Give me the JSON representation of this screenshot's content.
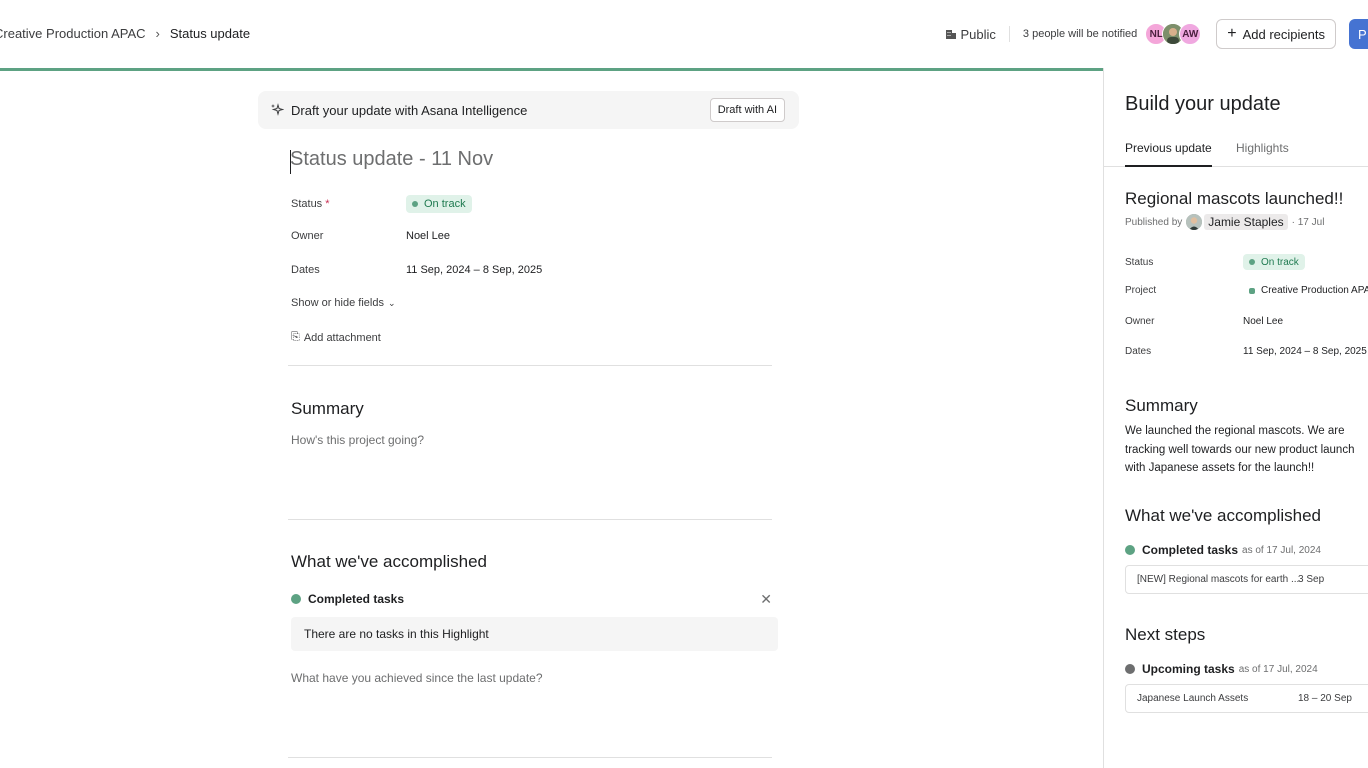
{
  "breadcrumb": {
    "parent": "Creative Production APAC",
    "current": "Status update"
  },
  "topbar": {
    "visibility": "Public",
    "notify_text": "3 people will be notified",
    "avatars": [
      "NL",
      "",
      "AW"
    ],
    "add_recipients": "Add recipients",
    "publish": "P"
  },
  "ai_banner": {
    "text": "Draft your update with Asana Intelligence",
    "button": "Draft with AI"
  },
  "editor": {
    "title_placeholder": "Status update - 11 Nov",
    "fields": {
      "status_label": "Status",
      "required_mark": "*",
      "status_value": "On track",
      "owner_label": "Owner",
      "owner_value": "Noel Lee",
      "dates_label": "Dates",
      "dates_value": "11 Sep, 2024 – 8 Sep, 2025"
    },
    "show_hide_fields": "Show or hide fields",
    "add_attachment": "Add attachment",
    "summary": {
      "heading": "Summary",
      "placeholder": "How's this project going?"
    },
    "accomplished": {
      "heading": "What we've accomplished",
      "highlight_label": "Completed tasks",
      "empty_text": "There are no tasks in this Highlight",
      "placeholder": "What have you achieved since the last update?"
    }
  },
  "panel": {
    "title": "Build your update",
    "tabs": [
      "Previous update",
      "Highlights"
    ],
    "prev": {
      "title": "Regional mascots launched!!",
      "published_by": "Published by",
      "author": "Jamie Staples",
      "date": "· 17 Jul",
      "status_label": "Status",
      "status_value": "On track",
      "project_label": "Project",
      "project_value": "Creative Production APAC",
      "owner_label": "Owner",
      "owner_value": "Noel Lee",
      "dates_label": "Dates",
      "dates_value": "11 Sep, 2024 – 8 Sep, 2025",
      "summary_heading": "Summary",
      "summary_text": "We launched the regional mascots. We are tracking well towards our new product launch with Japanese assets for the launch!!",
      "accomplished_heading": "What we've accomplished",
      "completed_label": "Completed tasks",
      "completed_asof": "as of 17 Jul, 2024",
      "completed_task": "[NEW] Regional mascots for earth ...",
      "completed_task_date": "3 Sep",
      "next_heading": "Next steps",
      "upcoming_label": "Upcoming tasks",
      "upcoming_asof": "as of 17 Jul, 2024",
      "upcoming_task": "Japanese Launch Assets",
      "upcoming_task_date": "18 – 20 Sep"
    }
  },
  "colors": {
    "accent_green": "#5da283",
    "primary_blue": "#4573d2",
    "required_red": "#c92f54",
    "upcoming_gray": "#6d6e6f"
  }
}
